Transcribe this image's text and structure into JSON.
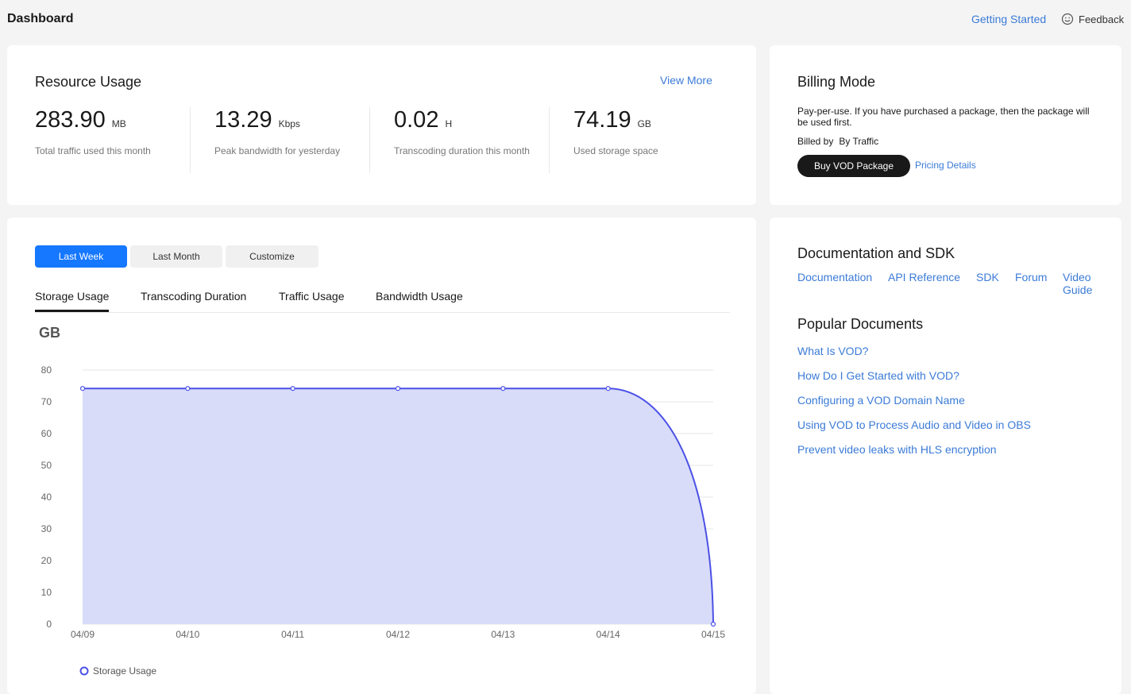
{
  "header": {
    "title": "Dashboard",
    "getting_started": "Getting Started",
    "feedback": "Feedback"
  },
  "resource": {
    "title": "Resource Usage",
    "view_more": "View More",
    "metrics": [
      {
        "value": "283.90",
        "unit": "MB",
        "label": "Total traffic used this month"
      },
      {
        "value": "13.29",
        "unit": "Kbps",
        "label": "Peak bandwidth for yesterday"
      },
      {
        "value": "0.02",
        "unit": "H",
        "label": "Transcoding duration this month"
      },
      {
        "value": "74.19",
        "unit": "GB",
        "label": "Used storage space"
      }
    ]
  },
  "billing": {
    "title": "Billing Mode",
    "description": "Pay-per-use. If you have purchased a package, then the package will be used first.",
    "billed_by_label": "Billed by",
    "billed_by_value": "By Traffic",
    "buy_button": "Buy VOD Package",
    "pricing_link": "Pricing Details"
  },
  "usage": {
    "ranges": [
      "Last Week",
      "Last Month",
      "Customize"
    ],
    "tabs": [
      "Storage Usage",
      "Transcoding Duration",
      "Traffic Usage",
      "Bandwidth Usage"
    ]
  },
  "chart_data": {
    "type": "area",
    "ylabel": "GB",
    "x": [
      "04/09",
      "04/10",
      "04/11",
      "04/12",
      "04/13",
      "04/14",
      "04/15"
    ],
    "series": [
      {
        "name": "Storage Usage",
        "values": [
          74.19,
          74.19,
          74.19,
          74.19,
          74.19,
          74.19,
          0
        ]
      }
    ],
    "ylim": [
      0,
      80
    ],
    "yticks": [
      0,
      10,
      20,
      30,
      40,
      50,
      60,
      70,
      80
    ],
    "grid": true,
    "legend": "bottom-left",
    "color": "#4b51e6",
    "fill": "#d9dcf8"
  },
  "docs": {
    "title": "Documentation and SDK",
    "links": [
      "Documentation",
      "API Reference",
      "SDK",
      "Forum",
      "Video Guide"
    ],
    "popular_title": "Popular Documents",
    "popular": [
      "What Is VOD?",
      "How Do I Get Started with VOD?",
      "Configuring a VOD Domain Name",
      "Using VOD to Process Audio and Video in OBS",
      "Prevent video leaks with HLS encryption"
    ]
  }
}
